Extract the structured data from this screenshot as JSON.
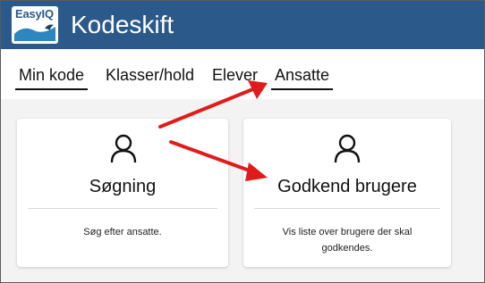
{
  "header": {
    "logo_text": "EasyIQ",
    "app_title": "Kodeskift",
    "background_color": "#2b5a8a"
  },
  "nav": {
    "tabs": [
      {
        "label": "Min kode",
        "underlined": true
      },
      {
        "label": "Klasser/hold",
        "underlined": false
      },
      {
        "label": "Elever",
        "underlined": false
      },
      {
        "label": "Ansatte",
        "underlined": true
      }
    ]
  },
  "cards": [
    {
      "icon": "user-icon",
      "title": "Søgning",
      "description": "Søg efter ansatte."
    },
    {
      "icon": "user-icon",
      "title": "Godkend brugere",
      "description": "Vis liste over brugere der skal godkendes."
    }
  ],
  "annotations": {
    "arrow_color": "#e01b1b",
    "arrows": [
      "arrow-to-ansatte-tab",
      "arrow-to-godkend-brugere"
    ]
  }
}
